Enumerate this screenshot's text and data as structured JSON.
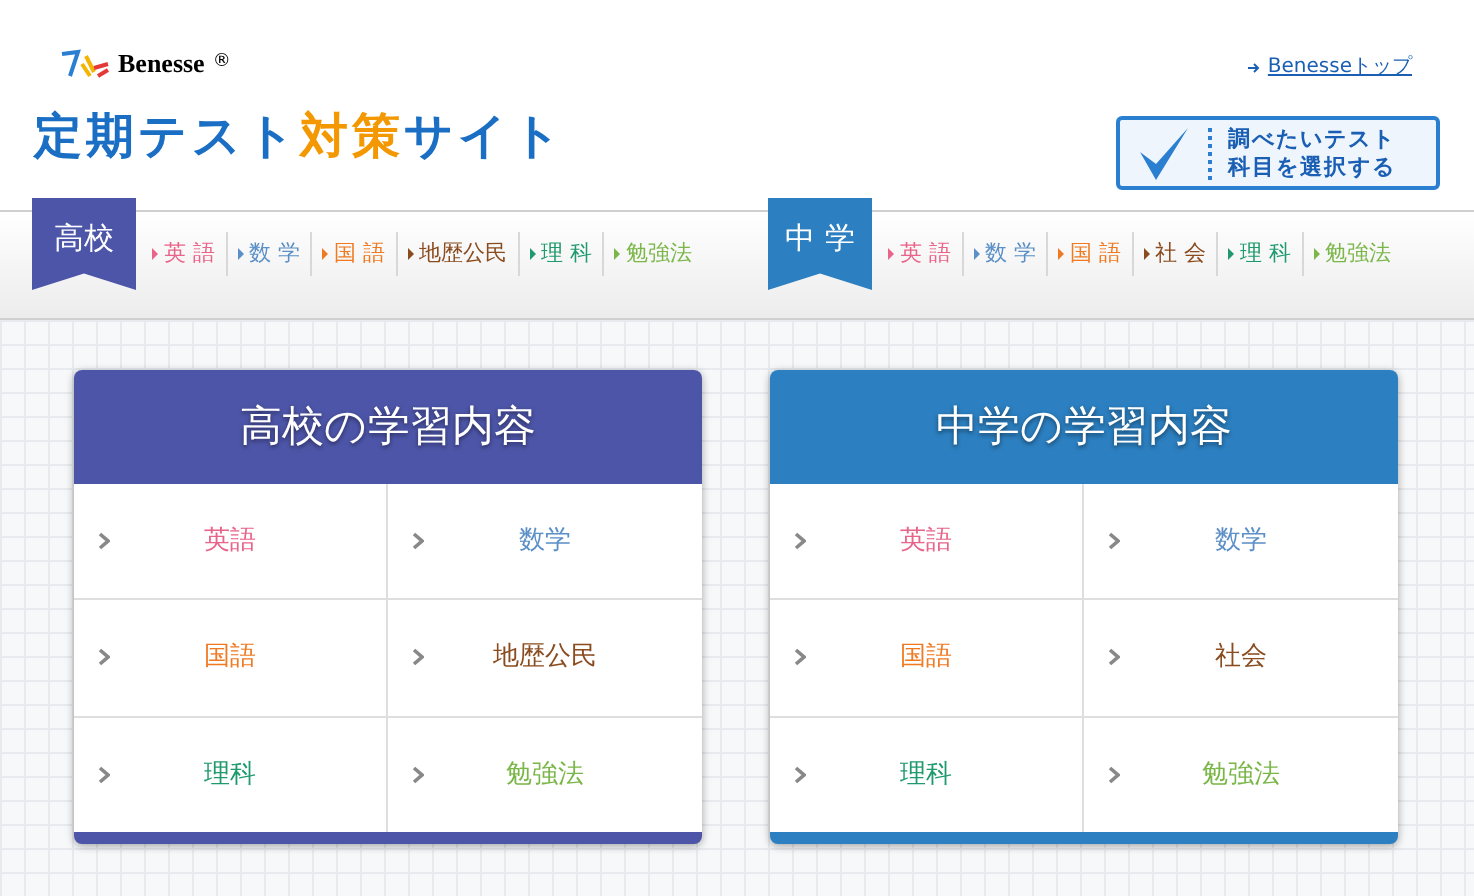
{
  "logo": {
    "text": "Benesse",
    "mark": "®"
  },
  "top_link": "Benesseトップ",
  "title": [
    {
      "text": "定期テスト",
      "color": "#1a6fc4"
    },
    {
      "text": "対策",
      "color": "#f39800"
    },
    {
      "text": "サイト",
      "color": "#1a6fc4"
    }
  ],
  "select_button": [
    "調べたいテスト",
    "科目を選択する"
  ],
  "nav": [
    {
      "label": "高校",
      "color": "#4d55a8",
      "items": [
        {
          "label": "英 語",
          "color": "#e8648a"
        },
        {
          "label": "数 学",
          "color": "#5b8fc7"
        },
        {
          "label": "国 語",
          "color": "#f07a22"
        },
        {
          "label": "地歴公民",
          "color": "#8a4b1e"
        },
        {
          "label": "理 科",
          "color": "#1f9a6e"
        },
        {
          "label": "勉強法",
          "color": "#7ab648"
        }
      ]
    },
    {
      "label": "中 学",
      "color": "#2c7fc0",
      "items": [
        {
          "label": "英 語",
          "color": "#e8648a"
        },
        {
          "label": "数 学",
          "color": "#5b8fc7"
        },
        {
          "label": "国 語",
          "color": "#f07a22"
        },
        {
          "label": "社 会",
          "color": "#8a4b1e"
        },
        {
          "label": "理 科",
          "color": "#1f9a6e"
        },
        {
          "label": "勉強法",
          "color": "#7ab648"
        }
      ]
    }
  ],
  "cards": [
    {
      "title": "高校の学習内容",
      "color": "#4d55a8",
      "items": [
        {
          "label": "英語",
          "color": "#e8648a"
        },
        {
          "label": "数学",
          "color": "#5b8fc7"
        },
        {
          "label": "国語",
          "color": "#f07a22"
        },
        {
          "label": "地歴公民",
          "color": "#8a4b1e"
        },
        {
          "label": "理科",
          "color": "#1f9a6e"
        },
        {
          "label": "勉強法",
          "color": "#7ab648"
        }
      ]
    },
    {
      "title": "中学の学習内容",
      "color": "#2c7fc0",
      "items": [
        {
          "label": "英語",
          "color": "#e8648a"
        },
        {
          "label": "数学",
          "color": "#5b8fc7"
        },
        {
          "label": "国語",
          "color": "#f07a22"
        },
        {
          "label": "社会",
          "color": "#8a4b1e"
        },
        {
          "label": "理科",
          "color": "#1f9a6e"
        },
        {
          "label": "勉強法",
          "color": "#7ab648"
        }
      ]
    }
  ]
}
